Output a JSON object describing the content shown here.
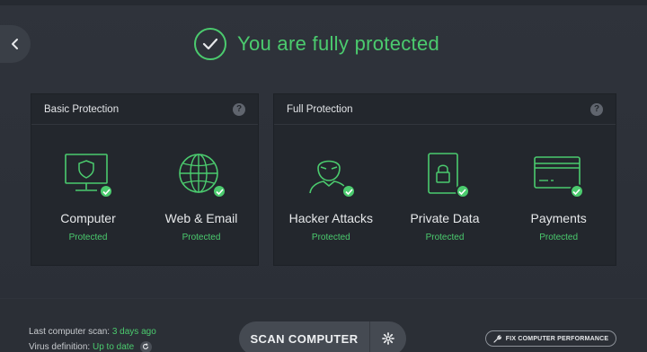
{
  "header": {
    "status_title": "You are fully protected"
  },
  "panels": [
    {
      "title": "Basic Protection",
      "help": "?",
      "items": [
        {
          "name": "Computer",
          "state": "Protected",
          "icon": "monitor-shield-icon"
        },
        {
          "name": "Web & Email",
          "state": "Protected",
          "icon": "globe-icon"
        }
      ]
    },
    {
      "title": "Full Protection",
      "help": "?",
      "items": [
        {
          "name": "Hacker Attacks",
          "state": "Protected",
          "icon": "hacker-icon"
        },
        {
          "name": "Private Data",
          "state": "Protected",
          "icon": "lock-document-icon"
        },
        {
          "name": "Payments",
          "state": "Protected",
          "icon": "credit-card-icon"
        }
      ]
    }
  ],
  "footer": {
    "last_scan_label": "Last computer scan:",
    "last_scan_value": "3 days ago",
    "virus_def_label": "Virus definition:",
    "virus_def_value": "Up to date",
    "scan_button": "SCAN COMPUTER",
    "fix_button": "FIX COMPUTER PERFORMANCE"
  },
  "colors": {
    "accent_green": "#4bcb6e",
    "background": "#2a2e36",
    "panel": "#23272d"
  }
}
